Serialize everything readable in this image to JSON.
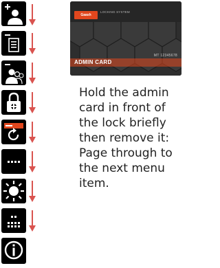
{
  "menu": {
    "items": [
      {
        "icon": "add-user-icon"
      },
      {
        "icon": "menu-list-icon"
      },
      {
        "icon": "remove-users-icon"
      },
      {
        "icon": "lock-icon"
      },
      {
        "icon": "card-reset-icon"
      },
      {
        "icon": "dots-icon"
      },
      {
        "icon": "brightness-icon"
      },
      {
        "icon": "grid-icon"
      },
      {
        "icon": "info-icon"
      }
    ],
    "arrow_color": "#d9534f"
  },
  "card": {
    "logo_text": "Gaash",
    "system_text": "LOCKING SYSTEM",
    "serial": "MT 12345678",
    "title": "ADMIN CARD",
    "brand_color": "#e1471e"
  },
  "instruction": "Hold the admin card in front of the lock briefly then remove it: Page through to the next menu item."
}
